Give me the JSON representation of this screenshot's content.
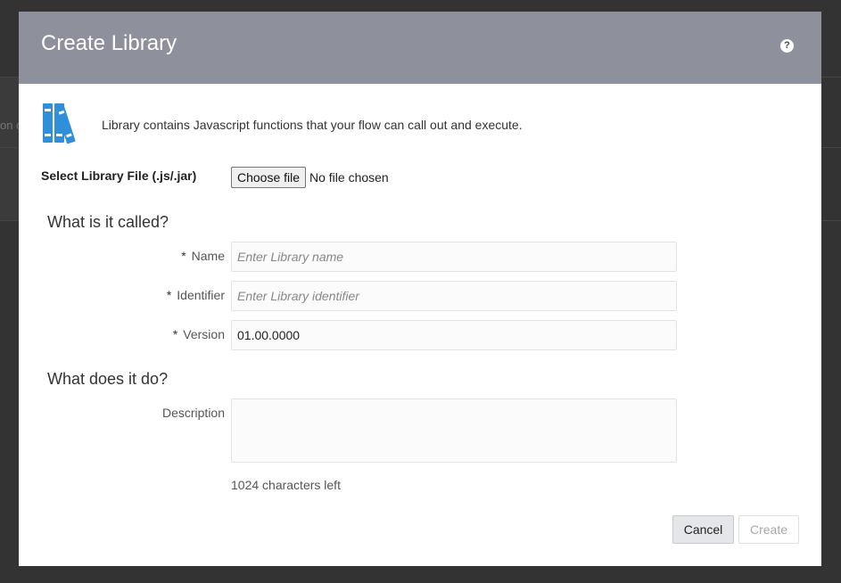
{
  "background": {
    "truncated_text": "on c"
  },
  "dialog": {
    "title": "Create Library",
    "help_glyph": "?",
    "intro": "Library contains Javascript functions that your flow can call out and execute.",
    "library_icon": "books-icon",
    "icon_color": "#2f8fd8",
    "header_color": "#8e909b"
  },
  "file_select": {
    "label": "Select Library File (.js/.jar)",
    "button_label": "Choose file",
    "status": "No file chosen"
  },
  "section_called": {
    "heading": "What is it called?"
  },
  "fields": {
    "name": {
      "required_mark": "*",
      "label": "Name",
      "placeholder": "Enter Library name",
      "value": ""
    },
    "identifier": {
      "required_mark": "*",
      "label": "Identifier",
      "placeholder": "Enter Library identifier",
      "value": ""
    },
    "version": {
      "required_mark": "*",
      "label": "Version",
      "placeholder": "",
      "value": "01.00.0000"
    }
  },
  "section_does": {
    "heading": "What does it do?"
  },
  "description": {
    "label": "Description",
    "value": "",
    "chars_left": "1024 characters left"
  },
  "footer": {
    "cancel_label": "Cancel",
    "create_label": "Create"
  }
}
